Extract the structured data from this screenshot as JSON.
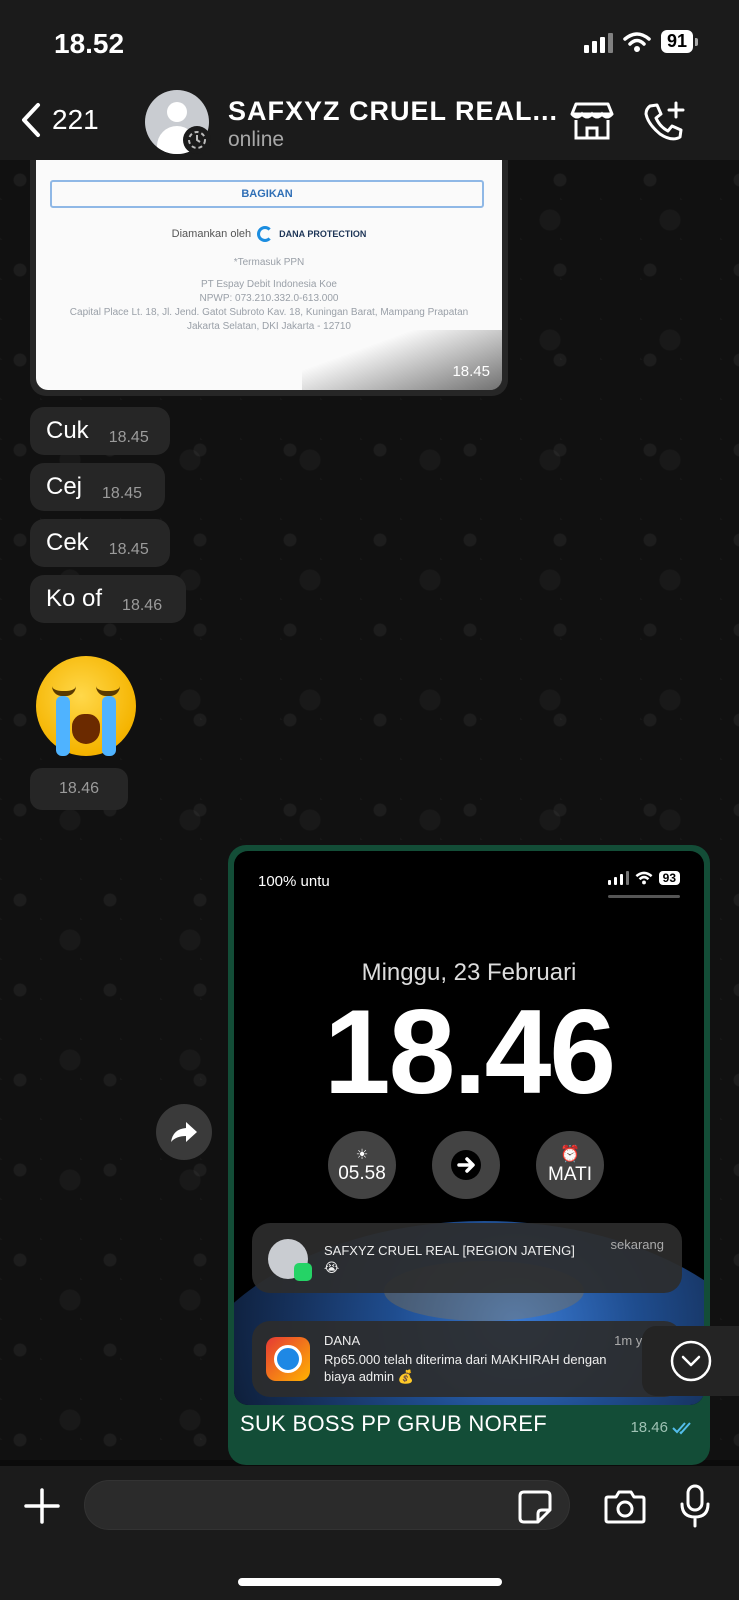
{
  "status_bar": {
    "time": "18.52",
    "battery": "91"
  },
  "header": {
    "back_count": "221",
    "contact_name": "SAFXYZ CRUEL REAL...",
    "contact_status": "online"
  },
  "messages": {
    "receipt_image": {
      "button": "BAGIKAN",
      "secured_by": "Diamankan oleh",
      "secured_brand": "DANA PROTECTION",
      "lines": [
        "*Termasuk PPN",
        "PT Espay Debit Indonesia Koe",
        "NPWP: 073.210.332.0-613.000",
        "Capital Place Lt. 18, Jl. Jend. Gatot Subroto Kav. 18, Kuningan Barat, Mampang Prapatan",
        "Jakarta Selatan, DKI Jakarta - 12710"
      ],
      "time": "18.45"
    },
    "texts": [
      {
        "text": "Cuk",
        "time": "18.45"
      },
      {
        "text": "Cej",
        "time": "18.45"
      },
      {
        "text": "Cek",
        "time": "18.45"
      },
      {
        "text": "Ko of",
        "time": "18.46"
      }
    ],
    "emoji_time": "18.46",
    "outgoing": {
      "screenshot": {
        "carrier_text": "100% untu",
        "battery": "93",
        "date": "Minggu, 23 Februari",
        "clock": "18.46",
        "widget_sunrise": "05.58",
        "widget_alarm": "MATI",
        "notif1_title": "SAFXYZ CRUEL REAL [REGION JATENG]",
        "notif1_when": "sekarang",
        "notif1_body": "😭",
        "notif2_title": "DANA",
        "notif2_when": "1m yang",
        "notif2_body_1": "Rp65.000 telah diterima dari MAKHIRAH dengan",
        "notif2_body_2": "biaya admin 💰"
      },
      "caption": "SUK BOSS PP GRUB NOREF",
      "time": "18.46"
    }
  },
  "input": {
    "value": "",
    "placeholder": ""
  },
  "colors": {
    "outgoing_bubble": "#134d37",
    "incoming_bubble": "#262626",
    "read_ticks": "#53bdeb"
  }
}
